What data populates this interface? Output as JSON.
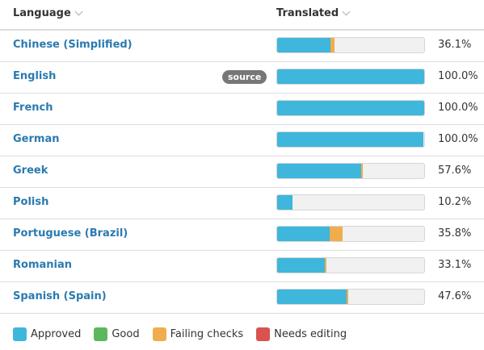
{
  "header": {
    "language_label": "Language",
    "translated_label": "Translated"
  },
  "colors": {
    "approved": "#3fb6dc",
    "good": "#5cb85c",
    "failing": "#f0ad4e",
    "needs_editing": "#d9534f",
    "link": "#2a7ab0"
  },
  "rows": [
    {
      "language": "Chinese (Simplified)",
      "badge": "",
      "approved": 0.36,
      "failing": 0.028,
      "percent": "36.1%"
    },
    {
      "language": "English",
      "badge": "source",
      "approved": 1.0,
      "failing": 0.0,
      "percent": "100.0%"
    },
    {
      "language": "French",
      "badge": "",
      "approved": 1.0,
      "failing": 0.0,
      "percent": "100.0%"
    },
    {
      "language": "German",
      "badge": "",
      "approved": 0.995,
      "failing": 0.0,
      "percent": "100.0%"
    },
    {
      "language": "Greek",
      "badge": "",
      "approved": 0.57,
      "failing": 0.012,
      "percent": "57.6%"
    },
    {
      "language": "Polish",
      "badge": "",
      "approved": 0.102,
      "failing": 0.0,
      "percent": "10.2%"
    },
    {
      "language": "Portuguese (Brazil)",
      "badge": "",
      "approved": 0.355,
      "failing": 0.092,
      "percent": "35.8%"
    },
    {
      "language": "Romanian",
      "badge": "",
      "approved": 0.325,
      "failing": 0.012,
      "percent": "33.1%"
    },
    {
      "language": "Spanish (Spain)",
      "badge": "",
      "approved": 0.47,
      "failing": 0.012,
      "percent": "47.6%"
    }
  ],
  "legend": [
    {
      "label": "Approved",
      "color": "#3fb6dc"
    },
    {
      "label": "Good",
      "color": "#5cb85c"
    },
    {
      "label": "Failing checks",
      "color": "#f0ad4e"
    },
    {
      "label": "Needs editing",
      "color": "#d9534f"
    }
  ]
}
